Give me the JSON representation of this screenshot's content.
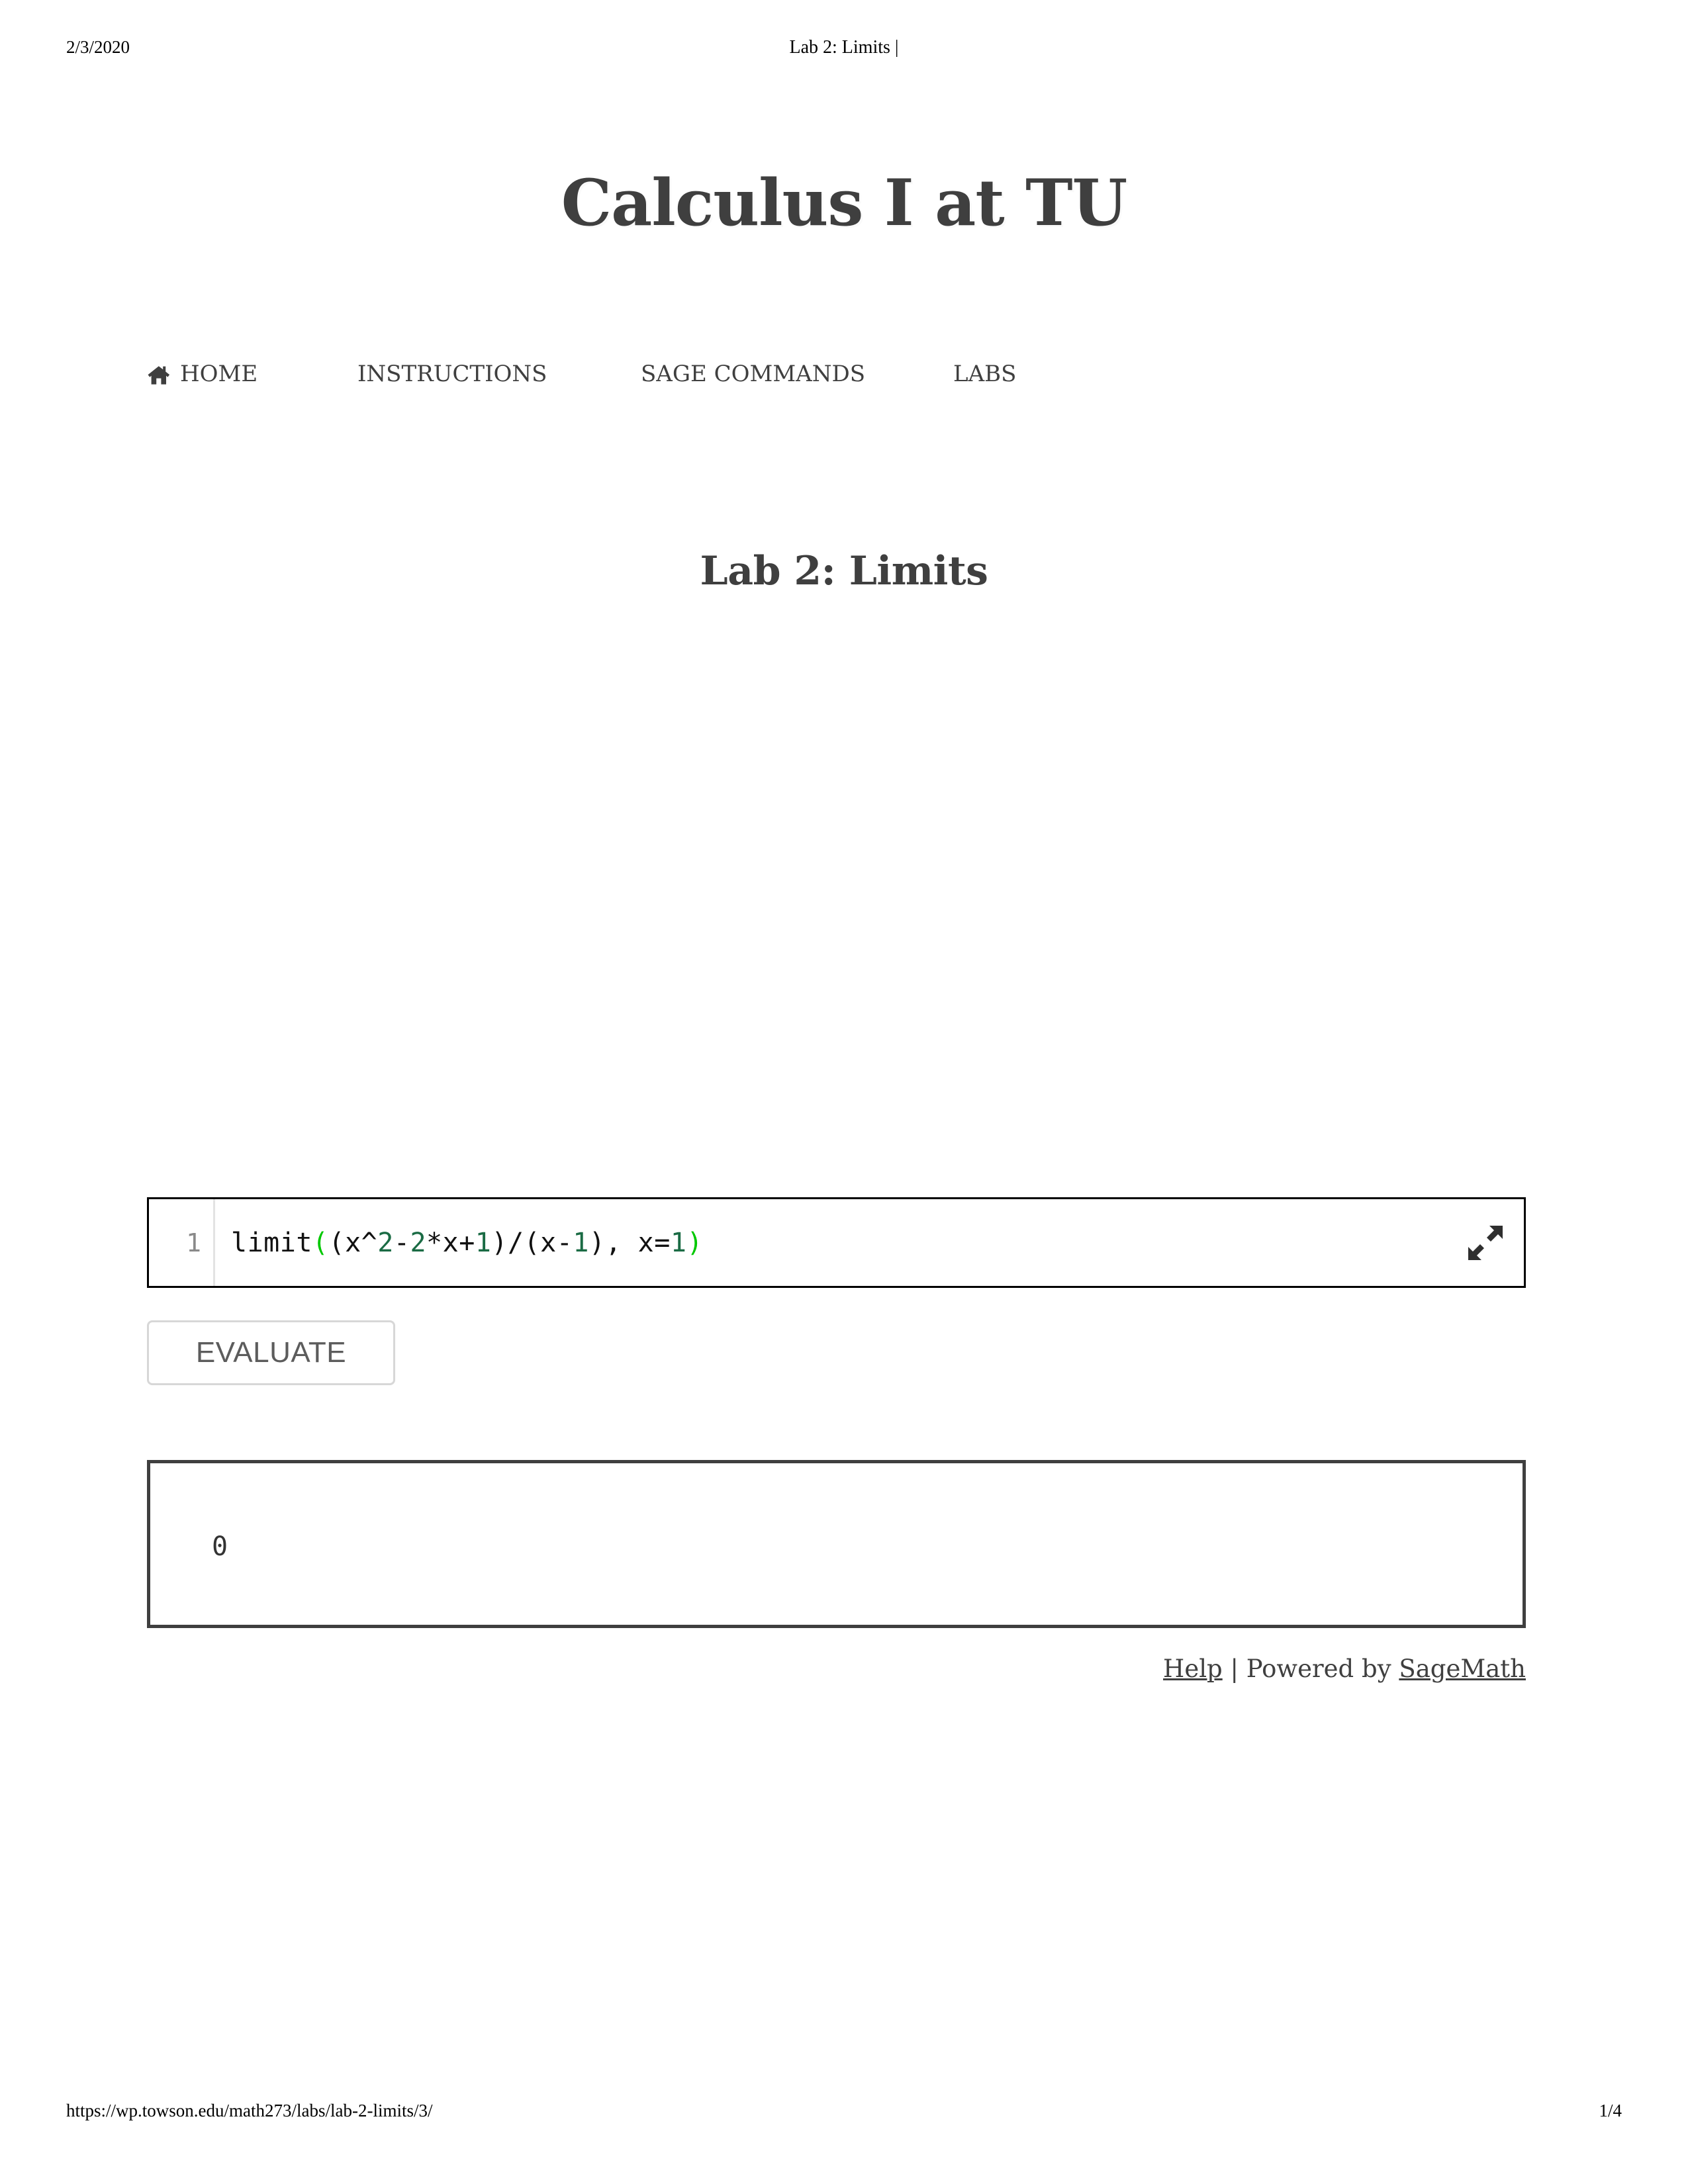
{
  "print_header": {
    "date": "2/3/2020",
    "document_title": "Lab 2: Limits |"
  },
  "site": {
    "title": "Calculus I at TU",
    "title_color": "#3f3f3f"
  },
  "nav": {
    "items": [
      {
        "label": "HOME",
        "icon": "home-icon"
      },
      {
        "label": "INSTRUCTIONS",
        "icon": ""
      },
      {
        "label": "SAGE COMMANDS",
        "icon": ""
      },
      {
        "label": "LABS",
        "icon": ""
      }
    ]
  },
  "page": {
    "title": "Lab 2: Limits"
  },
  "sagecell": {
    "line_number": "1",
    "code_full": "limit((x^2-2*x+1)/(x-1), x=1)",
    "code_tokens": [
      {
        "text": "limit",
        "type": "plain"
      },
      {
        "text": "(",
        "type": "match"
      },
      {
        "text": "(x^",
        "type": "plain"
      },
      {
        "text": "2",
        "type": "number"
      },
      {
        "text": "-",
        "type": "plain"
      },
      {
        "text": "2",
        "type": "number"
      },
      {
        "text": "*x+",
        "type": "plain"
      },
      {
        "text": "1",
        "type": "number"
      },
      {
        "text": ")/(x-",
        "type": "plain"
      },
      {
        "text": "1",
        "type": "number"
      },
      {
        "text": "), x=",
        "type": "plain"
      },
      {
        "text": "1",
        "type": "number"
      },
      {
        "text": ")",
        "type": "match"
      }
    ],
    "expand_icon": "expand-arrows-icon",
    "evaluate_label": "EVALUATE",
    "output_value": "0",
    "colors": {
      "number": "#1a6b44",
      "matching_bracket": "#00c800",
      "code_text": "#111111",
      "output_border": "#3f3f3f"
    },
    "footer": {
      "help_label": "Help",
      "separator": " | ",
      "powered_prefix": "Powered by ",
      "sagemath_label": "SageMath"
    }
  },
  "print_footer": {
    "url": "https://wp.towson.edu/math273/labs/lab-2-limits/3/",
    "page_number": "1/4"
  }
}
